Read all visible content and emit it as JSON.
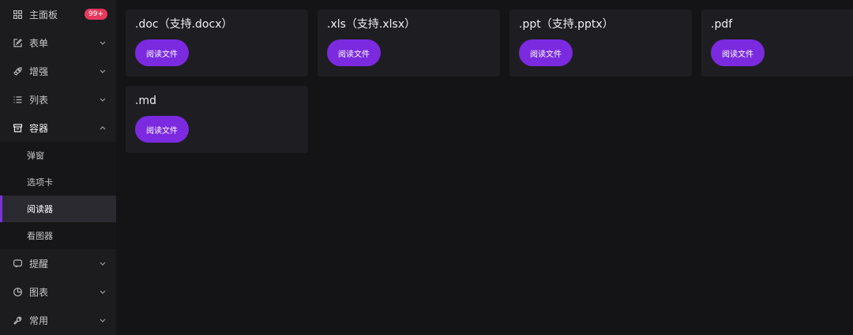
{
  "sidebar": {
    "dashboard": {
      "label": "主面板",
      "badge": "99+",
      "icon": "dashboard-grid-icon"
    },
    "form": {
      "label": "表单",
      "icon": "edit-square-icon"
    },
    "enhance": {
      "label": "增强",
      "icon": "rocket-icon"
    },
    "list": {
      "label": "列表",
      "icon": "list-icon"
    },
    "container": {
      "label": "容器",
      "icon": "archive-box-icon",
      "children": [
        "弹窗",
        "选项卡",
        "阅读器",
        "看图器"
      ],
      "active_child": "阅读器"
    },
    "reminder": {
      "label": "提醒",
      "icon": "message-icon"
    },
    "chart": {
      "label": "图表",
      "icon": "pie-chart-icon"
    },
    "common": {
      "label": "常用",
      "icon": "tool-icon"
    }
  },
  "cards": [
    {
      "title": ".doc（支持.docx）",
      "button": "阅读文件"
    },
    {
      "title": ".xls（支持.xlsx）",
      "button": "阅读文件"
    },
    {
      "title": ".ppt（支持.pptx）",
      "button": "阅读文件"
    },
    {
      "title": ".pdf",
      "button": "阅读文件"
    },
    {
      "title": ".md",
      "button": "阅读文件"
    }
  ],
  "colors": {
    "accent": "#7b2ae0",
    "badge": "#e8395d",
    "sidebar_bg": "#1c1c1f",
    "page_bg": "#141417",
    "card_bg": "#1e1e22"
  }
}
